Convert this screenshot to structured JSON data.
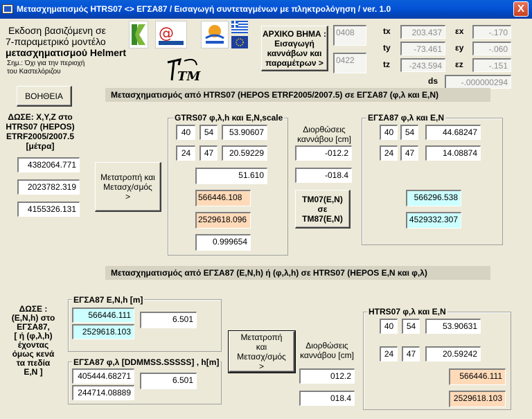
{
  "window": {
    "title": "Μετασχηματισμός HTRS07 <> ΕΓΣΑ87 / Εισαγωγή συντεταγμένων με πληκτρολόγηση / ver. 1.0",
    "close": "X"
  },
  "intro": {
    "line1": "Εκδοση βασιζόμενη σε",
    "line2": "7-παραμετρικό μοντέλο",
    "line3": "μετασχηματισμού Helmert",
    "note1": "Σημ.: Όχι για την περιοχή",
    "note2": "του Καστελόριζου"
  },
  "logos": {
    "brand": "TM"
  },
  "start_button": {
    "line1": "ΑΡΧΙΚΟ ΒΗΜΑ :",
    "line2": "Εισαγωγή",
    "line3": "καννάβων και",
    "line4": "παραμέτρων >"
  },
  "grid_ids": {
    "first": "0408",
    "second": "0422"
  },
  "params": {
    "tx_label": "tx",
    "tx": "203.437",
    "ty_label": "ty",
    "ty": "-73.461",
    "tz_label": "tz",
    "tz": "-243.594",
    "ex_label": "εx",
    "ex": "-.170",
    "ey_label": "εy",
    "ey": "-.060",
    "ez_label": "εz",
    "ez": "-.151",
    "ds_label": "ds",
    "ds": "-.000000294"
  },
  "help_button": "ΒΟΗΘΕΙΑ",
  "section1": {
    "banner": "Μετασχηματισμός από  HTRS07 (HEPOS ETRF2005/2007.5)  σε ΕΓΣΑ87 (φ,λ και  E,N)",
    "given_label": {
      "l1": "ΔΩΣΕ:  X,Y,Z στο",
      "l2": "HTRS07 (HEPOS)",
      "l3": "ETRF2005/2007.5",
      "l4": "[μέτρα]"
    },
    "x": "4382064.771",
    "y": "2023782.319",
    "z": "4155326.131",
    "convert_button": {
      "l1": "Μετατροπή και",
      "l2": "Μετασχ/σμός",
      "l3": ">"
    },
    "gtrs_group_title": "GTRS07 φ,λ,h και E,N,scale",
    "phi_deg": "40",
    "phi_min": "54",
    "phi_sec": "53.90607",
    "lam_deg": "24",
    "lam_min": "47",
    "lam_sec": "20.59229",
    "h": "51.610",
    "E": "566446.108",
    "N": "2529618.096",
    "scale": "0.999654",
    "corrections_label": {
      "l1": "Διορθώσεις",
      "l2": "καννάβου [cm]"
    },
    "corr_e": "-012.2",
    "corr_n": "-018.4",
    "tm_button": {
      "l1": "TM07(E,N)",
      "l2": "σε",
      "l3": "TM87(E,N)"
    },
    "egsa_group_title": "ΕΓΣΑ87 φ,λ      και E,N",
    "egsa_phi_deg": "40",
    "egsa_phi_min": "54",
    "egsa_phi_sec": "44.68247",
    "egsa_lam_deg": "24",
    "egsa_lam_min": "47",
    "egsa_lam_sec": "14.08874",
    "egsa_E": "566296.538",
    "egsa_N": "4529332.307"
  },
  "section2": {
    "banner": "Μετασχηματισμός από ΕΓΣΑ87 (E,N,h) ή (φ,λ,h)  σε  HTRS07 (HEPOS E,N και φ,λ)",
    "given_label": {
      "l1": "ΔΩΣΕ :",
      "l2": "(E,N,h) στο",
      "l3": "ΕΓΣΑ87,",
      "l4": "[ ή (φ,λ,h)",
      "l5": "έχοντας",
      "l6": "όμως κενά",
      "l7": "τα πεδία",
      "l8": "E,N ]"
    },
    "enh_group_title": "ΕΓΣΑ87 E,N,h [m]",
    "E": "566446.111",
    "N": "2529618.103",
    "h": "6.501",
    "dms_group_title": "ΕΓΣΑ87 φ,λ [DDMMSS.SSSSS] , h[m]",
    "phi": "405444.68271",
    "lam": "244714.08889",
    "h2": "6.501",
    "convert_button": {
      "l1": "Μετατροπή",
      "l2": "και",
      "l3": "Μετασχ/σμός",
      "l4": ">"
    },
    "corrections_label": {
      "l1": "Διορθώσεις",
      "l2": "καννάβου [cm]"
    },
    "corr_e": "012.2",
    "corr_n": "018.4",
    "htrs_group_title": "HTRS07 φ,λ    και E,N",
    "phi_deg": "40",
    "phi_min": "54",
    "phi_sec": "53.90631",
    "lam_deg": "24",
    "lam_min": "47",
    "lam_sec": "20.59242"
  }
}
